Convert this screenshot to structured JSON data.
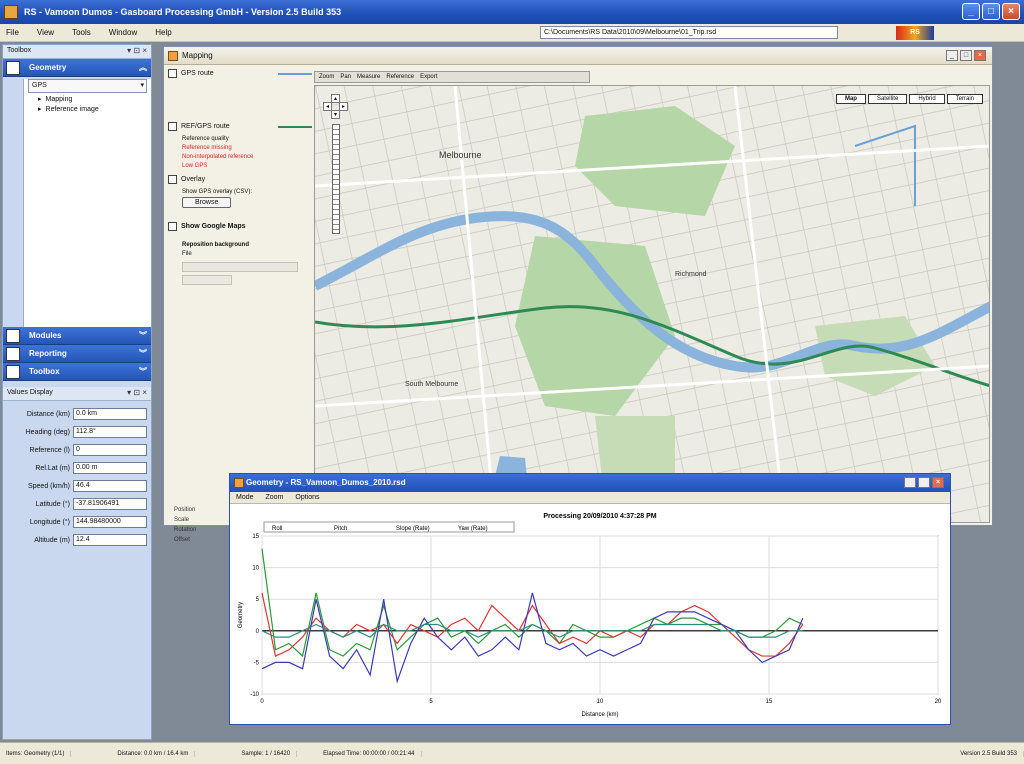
{
  "window": {
    "title": "RS - Vamoon Dumos - Gasboard Processing GmbH - Version 2.5 Build 353",
    "path": "C:\\Documents\\RS Data\\2010\\09\\Melbourne\\01_Trip.rsd",
    "logo": "RS"
  },
  "menu": [
    "File",
    "View",
    "Tools",
    "Window",
    "Help"
  ],
  "left_panel": {
    "header": "Toolbox",
    "sections": [
      {
        "label": "Geometry",
        "active": true
      },
      {
        "label": "Modules"
      },
      {
        "label": "Reporting"
      },
      {
        "label": "Toolbox"
      }
    ],
    "gps_selector": "GPS",
    "tree_items": [
      "Mapping",
      "Reference image"
    ],
    "values_header": "Values Display",
    "values": [
      {
        "label": "Distance (km)",
        "value": "0.0 km"
      },
      {
        "label": "Heading (deg)",
        "value": "112.8°"
      },
      {
        "label": "Reference (l)",
        "value": "0"
      },
      {
        "label": "Rel.Lat (m)",
        "value": "0.00 m"
      },
      {
        "label": "Speed (km/h)",
        "value": "46.4"
      },
      {
        "label": "Latitude (°)",
        "value": "-37.81906491"
      },
      {
        "label": "Longitude (°)",
        "value": "144.98480000"
      },
      {
        "label": "Altitude (m)",
        "value": "12.4"
      }
    ]
  },
  "map_window": {
    "title": "Mapping",
    "options": {
      "gps_label": "GPS route",
      "ref_label": "REF/GPS route",
      "ref_sub": "Reference quality",
      "warnings": [
        "Reference missing",
        "Non-interpolated reference",
        "Low GPS"
      ],
      "overlay_label": "Overlay",
      "overlay_sub": "Show GPS overlay (CSV):",
      "overlay_btn": "Browse",
      "google_label": "Show Google Maps",
      "background_label": "Reposition background",
      "background_sub": "File",
      "bottom_labels": [
        "Position",
        "Scale",
        "Rotation",
        "Offset"
      ]
    },
    "toolbar": [
      "Zoom",
      "Pan",
      "Measure",
      "Reference",
      "Export"
    ],
    "map_type_buttons": [
      "Map",
      "Satellite",
      "Hybrid",
      "Terrain"
    ],
    "map_labels": {
      "city": "Melbourne",
      "south": "South Melbourne",
      "richmond": "Richmond"
    }
  },
  "chart_window": {
    "title": "Geometry - RS_Vamoon_Dumos_2010.rsd",
    "menu": [
      "Mode",
      "Zoom",
      "Options"
    ],
    "legend": [
      "Roll",
      "Pitch",
      "Slope (Rate)",
      "Yaw (Rate)"
    ]
  },
  "chart_data": {
    "type": "line",
    "title": "Processing 20/09/2010 4:37:28 PM",
    "xlabel": "Distance (km)",
    "ylabel": "Geometry",
    "xlim": [
      0,
      20
    ],
    "ylim": [
      -10,
      15
    ],
    "x_ticks": [
      0,
      5,
      10,
      15,
      20
    ],
    "y_ticks": [
      15,
      10,
      5,
      0,
      -5,
      -10
    ],
    "series": [
      {
        "name": "Roll",
        "color": "#2a9a3a",
        "x": [
          0,
          0.4,
          0.8,
          1.2,
          1.6,
          2,
          2.4,
          2.8,
          3.2,
          3.6,
          4,
          4.4,
          4.8,
          5.2,
          5.6,
          6,
          6.4,
          6.8,
          7.2,
          7.6,
          8,
          8.4,
          8.8,
          9.2,
          9.6,
          10,
          10.4,
          10.8,
          11.2,
          11.6,
          12,
          12.4,
          12.8,
          13.2,
          13.6,
          14,
          14.4,
          14.8,
          15.2,
          15.6,
          16
        ],
        "values": [
          13,
          -3,
          -2,
          -4,
          6,
          -3,
          -4,
          -2,
          -3,
          4,
          -3,
          -1,
          1,
          2,
          -1,
          0,
          -2,
          0,
          1,
          -1,
          1,
          0,
          -2,
          1,
          0,
          -1,
          -1,
          0,
          1,
          2,
          1,
          2,
          2,
          1,
          1,
          0,
          -1,
          -1,
          0,
          2,
          1
        ]
      },
      {
        "name": "Pitch",
        "color": "#e03434",
        "x": [
          0,
          0.4,
          0.8,
          1.2,
          1.6,
          2,
          2.4,
          2.8,
          3.2,
          3.6,
          4,
          4.4,
          4.8,
          5.2,
          5.6,
          6,
          6.4,
          6.8,
          7.2,
          7.6,
          8,
          8.4,
          8.8,
          9.2,
          9.6,
          10,
          10.4,
          10.8,
          11.2,
          11.6,
          12,
          12.4,
          12.8,
          13.2,
          13.6,
          14,
          14.4,
          14.8,
          15.2,
          15.6,
          16
        ],
        "values": [
          6,
          -4,
          -3,
          -1,
          2,
          0,
          -1,
          1,
          0,
          1,
          -2,
          1,
          0,
          -1,
          1,
          2,
          0,
          4,
          2,
          0,
          4,
          1,
          -2,
          -1,
          -2,
          0,
          -1,
          0,
          -1,
          1,
          1,
          3,
          4,
          3,
          1,
          -1,
          -3,
          -4,
          -4,
          -2,
          1
        ]
      },
      {
        "name": "Slope (Rate)",
        "color": "#3a3ab8",
        "x": [
          0,
          0.4,
          0.8,
          1.2,
          1.6,
          2,
          2.4,
          2.8,
          3.2,
          3.6,
          4,
          4.4,
          4.8,
          5.2,
          5.6,
          6,
          6.4,
          6.8,
          7.2,
          7.6,
          8,
          8.4,
          8.8,
          9.2,
          9.6,
          10,
          10.4,
          10.8,
          11.2,
          11.6,
          12,
          12.4,
          12.8,
          13.2,
          13.6,
          14,
          14.4,
          14.8,
          15.2,
          15.6,
          16
        ],
        "values": [
          -6,
          -5,
          -5,
          -6,
          5,
          -4,
          -6,
          -3,
          -7,
          5,
          -8,
          -2,
          2,
          -1,
          -3,
          -1,
          -4,
          -3,
          -1,
          -3,
          6,
          -2,
          -3,
          -2,
          -4,
          -3,
          -4,
          -3,
          -2,
          2,
          3,
          3,
          3,
          2,
          1,
          0,
          -3,
          -5,
          -4,
          -3,
          2
        ]
      },
      {
        "name": "Yaw (Rate)",
        "color": "#2e8a7a",
        "x": [
          0,
          0.4,
          0.8,
          1.2,
          1.6,
          2,
          2.4,
          2.8,
          3.2,
          3.6,
          4,
          4.4,
          4.8,
          5.2,
          5.6,
          6,
          6.4,
          6.8,
          7.2,
          7.6,
          8,
          8.4,
          8.8,
          9.2,
          9.6,
          10,
          10.4,
          10.8,
          11.2,
          11.6,
          12,
          12.4,
          12.8,
          13.2,
          13.6,
          14,
          14.4,
          14.8,
          15.2,
          15.6,
          16
        ],
        "values": [
          0,
          -1,
          -1,
          0,
          1,
          0,
          -1,
          0,
          -1,
          1,
          0,
          0,
          1,
          1,
          0,
          0,
          -1,
          0,
          0,
          0,
          1,
          0,
          -1,
          0,
          0,
          0,
          0,
          0,
          0,
          1,
          1,
          1,
          1,
          1,
          0,
          0,
          -1,
          -1,
          -1,
          0,
          0
        ]
      }
    ]
  },
  "statusbar": [
    "Items: Geometry (1/1)",
    "Distance: 0.0 km / 16.4 km",
    "Sample: 1 / 16420",
    "Elapsed Time: 00:00:00 / 00:21:44",
    "Version 2.5 Build 353"
  ],
  "colors": {
    "titlebar": "#1f4fb8",
    "route_blue": "#6aa0d8",
    "route_green": "#2d8a55",
    "park": "#b5d6a6",
    "river": "#8ab4dc"
  }
}
